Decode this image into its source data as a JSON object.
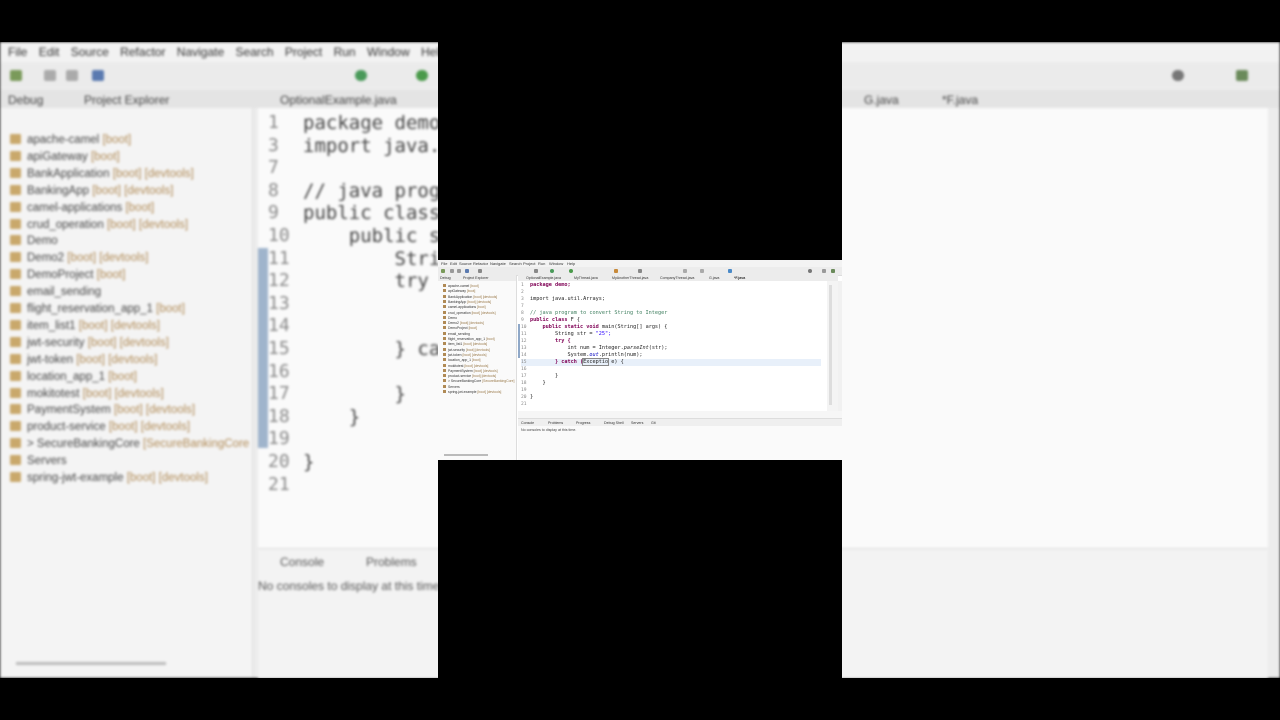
{
  "background": {
    "menu": [
      "File",
      "Edit",
      "Source",
      "Refactor",
      "Navigate",
      "Search",
      "Project",
      "Run",
      "Window",
      "Help"
    ],
    "left_tabs": [
      "Debug",
      "Project Explorer"
    ],
    "editor_tabs_left": [
      "OptionalExample.java"
    ],
    "editor_tabs_right": [
      "G.java",
      "*F.java"
    ],
    "explorer_items": [
      {
        "name": "apache-camel",
        "tag": "[boot]"
      },
      {
        "name": "apiGateway",
        "tag": "[boot]"
      },
      {
        "name": "BankApplication",
        "tag": "[boot] [devtools]"
      },
      {
        "name": "BankingApp",
        "tag": "[boot] [devtools]"
      },
      {
        "name": "camel-applications",
        "tag": "[boot]"
      },
      {
        "name": "crud_operation",
        "tag": "[boot] [devtools]"
      },
      {
        "name": "Demo",
        "tag": ""
      },
      {
        "name": "Demo2",
        "tag": "[boot] [devtools]"
      },
      {
        "name": "DemoProject",
        "tag": "[boot]"
      },
      {
        "name": "email_sending",
        "tag": ""
      },
      {
        "name": "flight_reservation_app_1",
        "tag": "[boot]"
      },
      {
        "name": "item_list1",
        "tag": "[boot] [devtools]"
      },
      {
        "name": "jwt-security",
        "tag": "[boot] [devtools]"
      },
      {
        "name": "jwt-token",
        "tag": "[boot] [devtools]"
      },
      {
        "name": "location_app_1",
        "tag": "[boot]"
      },
      {
        "name": "mokitotest",
        "tag": "[boot] [devtools]"
      },
      {
        "name": "PaymentSystem",
        "tag": "[boot] [devtools]"
      },
      {
        "name": "product-service",
        "tag": "[boot] [devtools]"
      },
      {
        "name": "> SecureBankingCore",
        "tag": "[SecureBankingCore"
      },
      {
        "name": "Servers",
        "tag": ""
      },
      {
        "name": "spring-jwt-example",
        "tag": "[boot] [devtools]"
      }
    ],
    "code_lines": [
      {
        "n": "1",
        "t": "package demo"
      },
      {
        "n": "3",
        "t": "import java."
      },
      {
        "n": "7",
        "t": ""
      },
      {
        "n": "8",
        "t": "// java prog"
      },
      {
        "n": "9",
        "t": "public class"
      },
      {
        "n": "10",
        "t": "    public s"
      },
      {
        "n": "11",
        "t": "        Stri"
      },
      {
        "n": "12",
        "t": "        try"
      },
      {
        "n": "13",
        "t": ""
      },
      {
        "n": "14",
        "t": ""
      },
      {
        "n": "15",
        "t": "        } ca"
      },
      {
        "n": "16",
        "t": ""
      },
      {
        "n": "17",
        "t": "        }"
      },
      {
        "n": "18",
        "t": "    }"
      },
      {
        "n": "19",
        "t": ""
      },
      {
        "n": "20",
        "t": "}"
      },
      {
        "n": "21",
        "t": ""
      }
    ],
    "console_tab": "Console",
    "problems_tab": "Problems",
    "console_msg": "No consoles to display at this time."
  },
  "frame": {
    "menu": [
      "File",
      "Edit",
      "Source",
      "Refactor",
      "Navigate",
      "Search",
      "Project",
      "Run",
      "Window",
      "Help"
    ],
    "left_tabs": [
      "Debug",
      "Project Explorer"
    ],
    "editor_tabs": [
      "OptionalExample.java",
      "MyThread.java",
      "MyAnotherThread.java",
      "CompanyThread.java",
      "G.java",
      "*F.java"
    ],
    "explorer_items": [
      {
        "name": "apache-camel",
        "tag": "[boot]"
      },
      {
        "name": "apiGateway",
        "tag": "[boot]"
      },
      {
        "name": "BankApplication",
        "tag": "[boot] [devtools]"
      },
      {
        "name": "BankingApp",
        "tag": "[boot] [devtools]"
      },
      {
        "name": "camel-applications",
        "tag": "[boot]"
      },
      {
        "name": "crud_operation",
        "tag": "[boot] [devtools]"
      },
      {
        "name": "Demo",
        "tag": ""
      },
      {
        "name": "Demo2",
        "tag": "[boot] [devtools]"
      },
      {
        "name": "DemoProject",
        "tag": "[boot]"
      },
      {
        "name": "email_sending",
        "tag": ""
      },
      {
        "name": "flight_reservation_app_1",
        "tag": "[boot]"
      },
      {
        "name": "item_list1",
        "tag": "[boot] [devtools]"
      },
      {
        "name": "jwt-security",
        "tag": "[boot] [devtools]"
      },
      {
        "name": "jwt-token",
        "tag": "[boot] [devtools]"
      },
      {
        "name": "location_app_1",
        "tag": "[boot]"
      },
      {
        "name": "mokitotest",
        "tag": "[boot] [devtools]"
      },
      {
        "name": "PaymentSystem",
        "tag": "[boot] [devtools]"
      },
      {
        "name": "product-service",
        "tag": "[boot] [devtools]"
      },
      {
        "name": "> SecureBankingCore",
        "tag": "[SecureBankingCore]"
      },
      {
        "name": "Servers",
        "tag": ""
      },
      {
        "name": "spring-jwt-example",
        "tag": "[boot] [devtools]"
      }
    ],
    "code": {
      "l1": "package demo;",
      "l3": "import java.util.Arrays;",
      "l8": "// java program to convert String to Integer",
      "l9a": "public class",
      "l9b": "F {",
      "l10a": "public static void",
      "l10b": "main(String[] args) {",
      "l11a": "String str =",
      "l11b": "\"25\";",
      "l12": "try {",
      "l13a": "int num = Integer.",
      "l13b": "parseInt",
      "l13c": "(str);",
      "l14a": "System.",
      "l14b": "out",
      "l14c": ".println(num);",
      "l15a": "} catch (",
      "l15b": "Exceptio",
      "l15c": " e) {",
      "l17": "}",
      "l18": "}",
      "l20": "}"
    },
    "console_tabs": [
      "Console",
      "Problems",
      "Progress",
      "Debug Shell",
      "Servers",
      "Git"
    ],
    "console_msg": "No consoles to display at this time."
  },
  "colors": {
    "keyword": "#7f0055",
    "comment": "#3f7f5f",
    "string": "#2a00ff",
    "boot_tag": "#b08a55"
  }
}
